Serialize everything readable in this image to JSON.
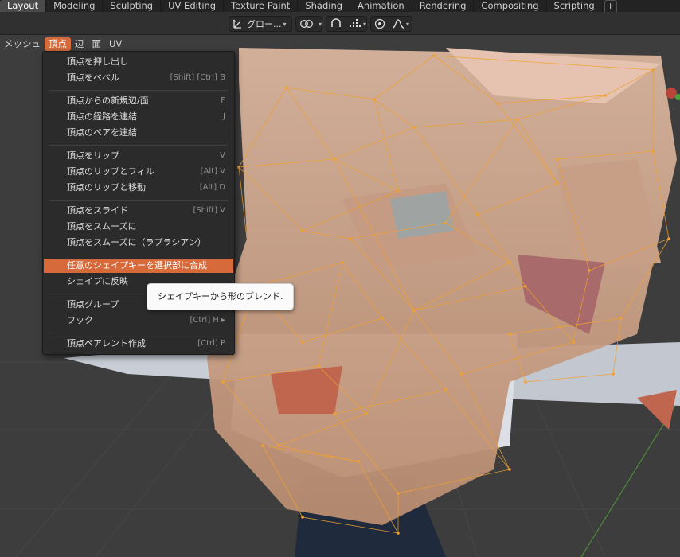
{
  "workspace_tabs": [
    "Layout",
    "Modeling",
    "Sculpting",
    "UV Editing",
    "Texture Paint",
    "Shading",
    "Animation",
    "Rendering",
    "Compositing",
    "Scripting"
  ],
  "workspace_add": "+",
  "header": {
    "transform_orientation": "グロー...",
    "snap_icon": "snap-icon",
    "proportional_icon": "proportional-falloff-icon"
  },
  "editor_menu": {
    "mesh": "メッシュ",
    "vertex": "頂点",
    "edge": "辺",
    "face": "面",
    "uv": "UV"
  },
  "dropdown": {
    "items": [
      {
        "label": "頂点を押し出し",
        "shortcut": ""
      },
      {
        "label": "頂点をベベル",
        "shortcut": "[Shift] [Ctrl] B"
      },
      {
        "label": "頂点からの新規辺/面",
        "shortcut": "F"
      },
      {
        "label": "頂点の経路を連結",
        "shortcut": "J"
      },
      {
        "label": "頂点のペアを連結",
        "shortcut": ""
      },
      {
        "label": "頂点をリップ",
        "shortcut": "V"
      },
      {
        "label": "頂点のリップとフィル",
        "shortcut": "[Alt] V"
      },
      {
        "label": "頂点のリップと移動",
        "shortcut": "[Alt] D"
      },
      {
        "label": "頂点をスライド",
        "shortcut": "[Shift] V"
      },
      {
        "label": "頂点をスムーズに",
        "shortcut": ""
      },
      {
        "label": "頂点をスムーズに（ラプラシアン）",
        "shortcut": ""
      },
      {
        "label": "任意のシェイプキーを選択部に合成",
        "shortcut": ""
      },
      {
        "label": "シェイプに反映",
        "shortcut": ""
      },
      {
        "label": "頂点グループ",
        "shortcut": ""
      },
      {
        "label": "フック",
        "shortcut": "[Ctrl] H ▸"
      },
      {
        "label": "頂点ペアレント作成",
        "shortcut": "[Ctrl] P"
      }
    ]
  },
  "tooltip": "シェイプキーから形のブレンド.",
  "colors": {
    "accent": "#d66a3b",
    "wire": "#f0a030",
    "background": "#3d3d3d"
  }
}
